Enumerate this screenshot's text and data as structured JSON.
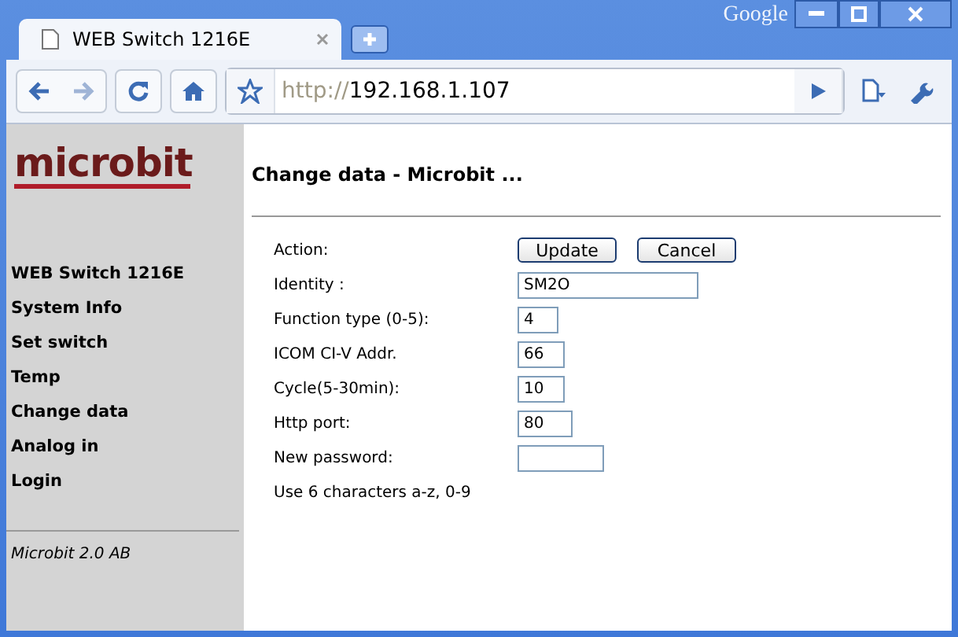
{
  "window": {
    "brand": "Google"
  },
  "tabs": [
    {
      "title": "WEB Switch 1216E",
      "selected": true
    }
  ],
  "address_bar": {
    "scheme": "http://",
    "host": "192.168.1.107"
  },
  "sidebar": {
    "logo": "microbit",
    "items": [
      {
        "label": "WEB Switch 1216E"
      },
      {
        "label": "System Info"
      },
      {
        "label": "Set switch"
      },
      {
        "label": "Temp"
      },
      {
        "label": "Change data"
      },
      {
        "label": "Analog in"
      },
      {
        "label": "Login"
      }
    ],
    "footer": "Microbit 2.0 AB"
  },
  "page": {
    "title": "Change data - Microbit ...",
    "rows": [
      {
        "kind": "buttons",
        "label": "Action:",
        "buttons": [
          "Update",
          "Cancel"
        ]
      },
      {
        "kind": "field",
        "label": "Identity :",
        "value": "SM2O"
      },
      {
        "kind": "field",
        "label": "Function type (0-5):",
        "value": "4"
      },
      {
        "kind": "field",
        "label": "ICOM CI-V Addr.",
        "value": "66"
      },
      {
        "kind": "field",
        "label": "Cycle(5-30min):",
        "value": "10"
      },
      {
        "kind": "field",
        "label": "Http port:",
        "value": "80"
      },
      {
        "kind": "field",
        "label": "New password:"
      },
      {
        "kind": "note",
        "label": "Use 6 characters a-z, 0-9"
      }
    ]
  }
}
